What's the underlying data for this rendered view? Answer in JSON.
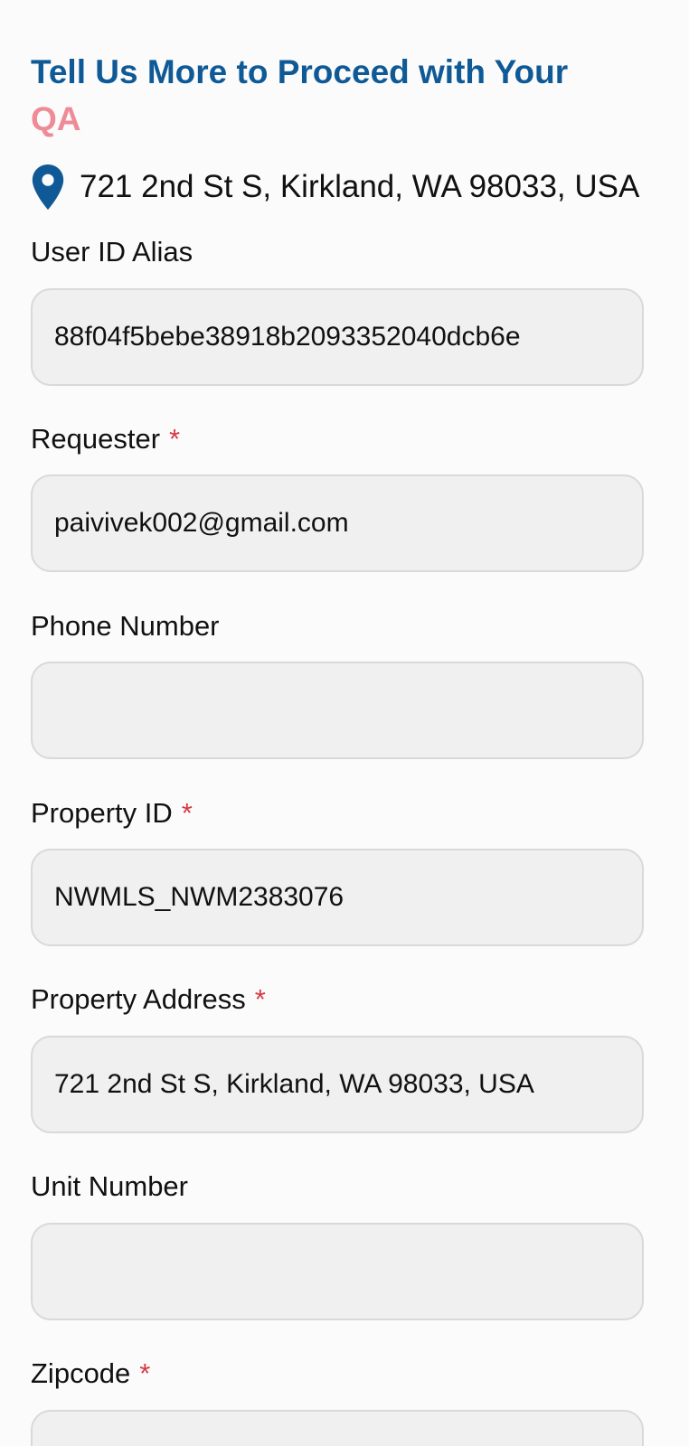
{
  "header": {
    "title_line1": "Tell Us More to Proceed with Your",
    "title_line2": "QA",
    "location_text": "721 2nd St S, Kirkland, WA 98033, USA"
  },
  "form": {
    "user_id_alias": {
      "label": "User ID Alias",
      "value": "88f04f5bebe38918b2093352040dcb6e",
      "placeholder": ""
    },
    "requester": {
      "label": "Requester",
      "required_mark": "*",
      "value": "paivivek002@gmail.com",
      "placeholder": ""
    },
    "phone_number": {
      "label": "Phone Number",
      "value": "",
      "placeholder": ""
    },
    "property_id": {
      "label": "Property ID",
      "required_mark": "*",
      "value": "NWMLS_NWM2383076",
      "placeholder": ""
    },
    "property_address": {
      "label": "Property Address",
      "required_mark": "*",
      "value": "721 2nd St S, Kirkland, WA 98033, USA",
      "placeholder": ""
    },
    "unit_number": {
      "label": "Unit Number",
      "value": "",
      "placeholder": ""
    },
    "zipcode": {
      "label": "Zipcode",
      "required_mark": "*",
      "value": "",
      "placeholder": ""
    }
  },
  "colors": {
    "title": "#0f5a96",
    "accent": "#ef8b97",
    "required": "#d63b45",
    "field_bg": "#f0f0f0",
    "field_border": "#d9d9d9"
  },
  "icons": {
    "location": "location-pin-icon"
  }
}
